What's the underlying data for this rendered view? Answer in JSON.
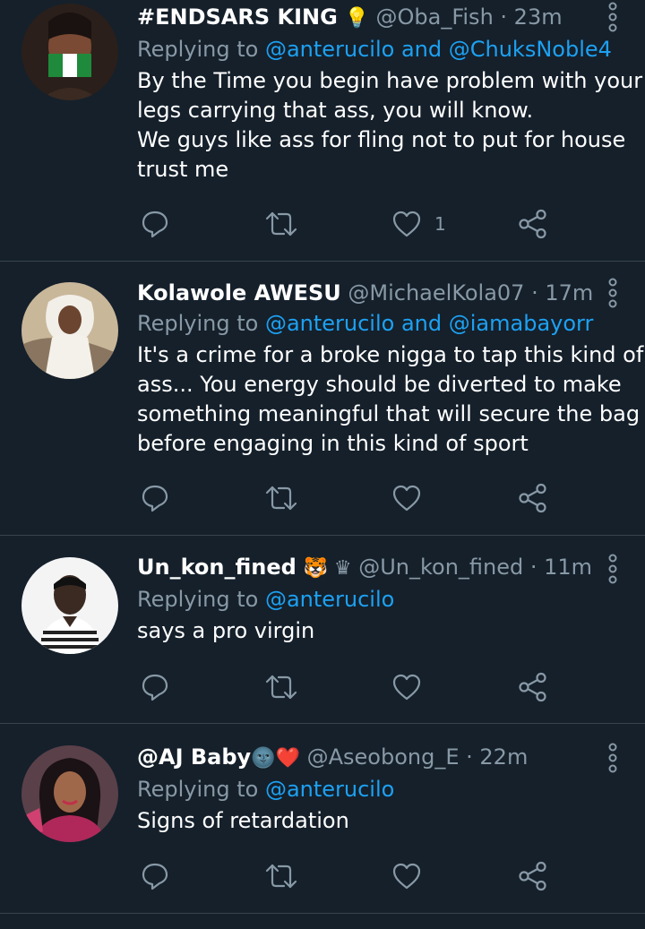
{
  "tweets": [
    {
      "display_name": "#ENDSARS KING",
      "name_emoji": "💡",
      "handle": "@Oba_Fish",
      "separator": " · ",
      "time": "23m",
      "replying_prefix": "Replying to ",
      "mentions": [
        "@anterucilo",
        "@ChuksNoble4"
      ],
      "mention_joiner": " and ",
      "body_lines": [
        "By the Time you begin have problem with your",
        "legs carrying that ass, you will know.",
        "We guys like ass for fling not to put for house",
        "trust me"
      ],
      "like_count": "1"
    },
    {
      "display_name": "Kolawole AWESU",
      "name_emoji": "",
      "handle": "@MichaelKola07",
      "separator": " · ",
      "time": "17m",
      "replying_prefix": "Replying to ",
      "mentions": [
        "@anterucilo",
        "@iamabayorr"
      ],
      "mention_joiner": " and ",
      "body_lines": [
        "It's a crime for a broke nigga to tap this kind of",
        "ass... You energy should be diverted to make",
        "something meaningful that will secure the bag",
        "before engaging in this kind of sport"
      ],
      "like_count": ""
    },
    {
      "display_name": "Un_kon_fined",
      "name_emoji": "🐯 ♛",
      "handle": "@Un_kon_fined",
      "separator": " · ",
      "time": "11m",
      "replying_prefix": "Replying to ",
      "mentions": [
        "@anterucilo"
      ],
      "mention_joiner": "",
      "body_lines": [
        "says a pro virgin"
      ],
      "like_count": ""
    },
    {
      "display_name": "@AJ Baby",
      "name_emoji": "🌚❤️",
      "handle": "@Aseobong_E",
      "separator": " · ",
      "time": "22m",
      "replying_prefix": "Replying to ",
      "mentions": [
        "@anterucilo"
      ],
      "mention_joiner": "",
      "body_lines": [
        "Signs of retardation"
      ],
      "like_count": ""
    }
  ],
  "icons": {
    "reply": "reply-bubble-icon",
    "retweet": "retweet-icon",
    "like": "heart-icon",
    "share": "share-icon",
    "more": "vertical-ellipsis-icon"
  },
  "colors": {
    "background": "#15202b",
    "divider": "#38444d",
    "text_primary": "#ffffff",
    "text_secondary": "#8899a6",
    "accent": "#1da1f2"
  }
}
